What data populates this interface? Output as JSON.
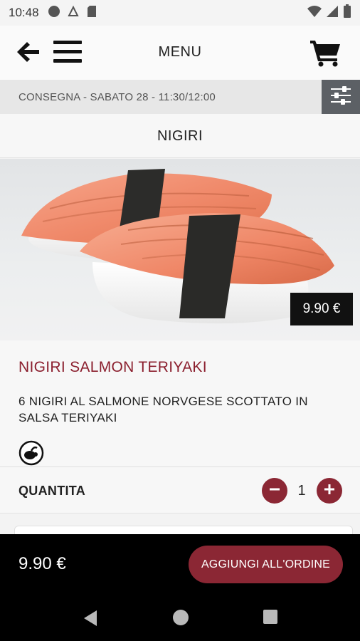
{
  "status_bar": {
    "time": "10:48",
    "icons": [
      "record-icon",
      "notification-icon",
      "sd-card-icon",
      "wifi-icon",
      "signal-icon",
      "battery-icon"
    ]
  },
  "header": {
    "title": "MENU",
    "back_icon": "arrow-left-icon",
    "menu_icon": "hamburger-icon",
    "cart_icon": "shopping-cart-icon"
  },
  "delivery": {
    "text": "CONSEGNA - SABATO 28 - 11:30/12:00",
    "filter_icon": "sliders-icon"
  },
  "category": {
    "title": "NIGIRI"
  },
  "product": {
    "image": "nigiri-salmon-photo",
    "price": "9.90 €",
    "name": "NIGIRI SALMON TERIYAKI",
    "description": "6 NIGIRI AL SALMONE NORVGESE SCOTTATO IN SALSA TERIYAKI",
    "allergen_icon": "allergen-icon"
  },
  "quantity": {
    "label": "QUANTITA",
    "value": "1"
  },
  "footer": {
    "total": "9.90 €",
    "add_button": "AGGIUNGI ALL'ORDINE"
  },
  "colors": {
    "accent": "#8b2734",
    "product_name": "#8b1f2e",
    "filter_bg": "#5c6065",
    "footer_bg": "#000000"
  }
}
